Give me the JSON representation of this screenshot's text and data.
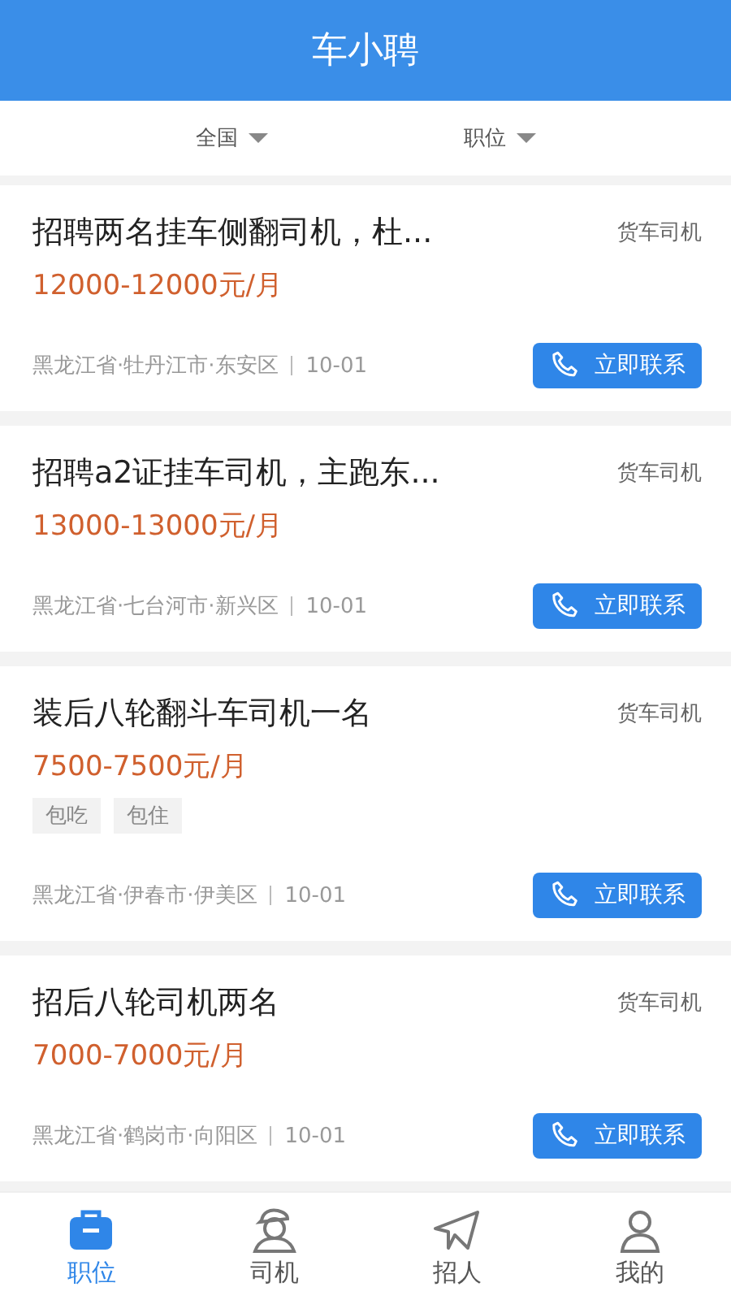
{
  "header": {
    "title": "车小聘"
  },
  "filters": [
    {
      "label": "全国"
    },
    {
      "label": "职位"
    }
  ],
  "jobs": [
    {
      "title": "招聘两名挂车侧翻司机，杜...",
      "category": "货车司机",
      "salary": "12000-12000元/月",
      "location": "黑龙江省·牡丹江市·东安区",
      "date": "10-01",
      "button": "立即联系"
    },
    {
      "title": "招聘a2证挂车司机，主跑东...",
      "category": "货车司机",
      "salary": "13000-13000元/月",
      "location": "黑龙江省·七台河市·新兴区",
      "date": "10-01",
      "button": "立即联系"
    },
    {
      "title": "装后八轮翻斗车司机一名",
      "category": "货车司机",
      "salary": "7500-7500元/月",
      "tags": [
        "包吃",
        "包住"
      ],
      "location": "黑龙江省·伊春市·伊美区",
      "date": "10-01",
      "button": "立即联系"
    },
    {
      "title": "招后八轮司机两名",
      "category": "货车司机",
      "salary": "7000-7000元/月",
      "location": "黑龙江省·鹤岗市·向阳区",
      "date": "10-01",
      "button": "立即联系"
    }
  ],
  "nav": [
    {
      "label": "职位",
      "kind": "briefcase",
      "selected": true
    },
    {
      "label": "司机",
      "kind": "driver",
      "selected": false
    },
    {
      "label": "招人",
      "kind": "plane",
      "selected": false
    },
    {
      "label": "我的",
      "kind": "person",
      "selected": false
    }
  ]
}
